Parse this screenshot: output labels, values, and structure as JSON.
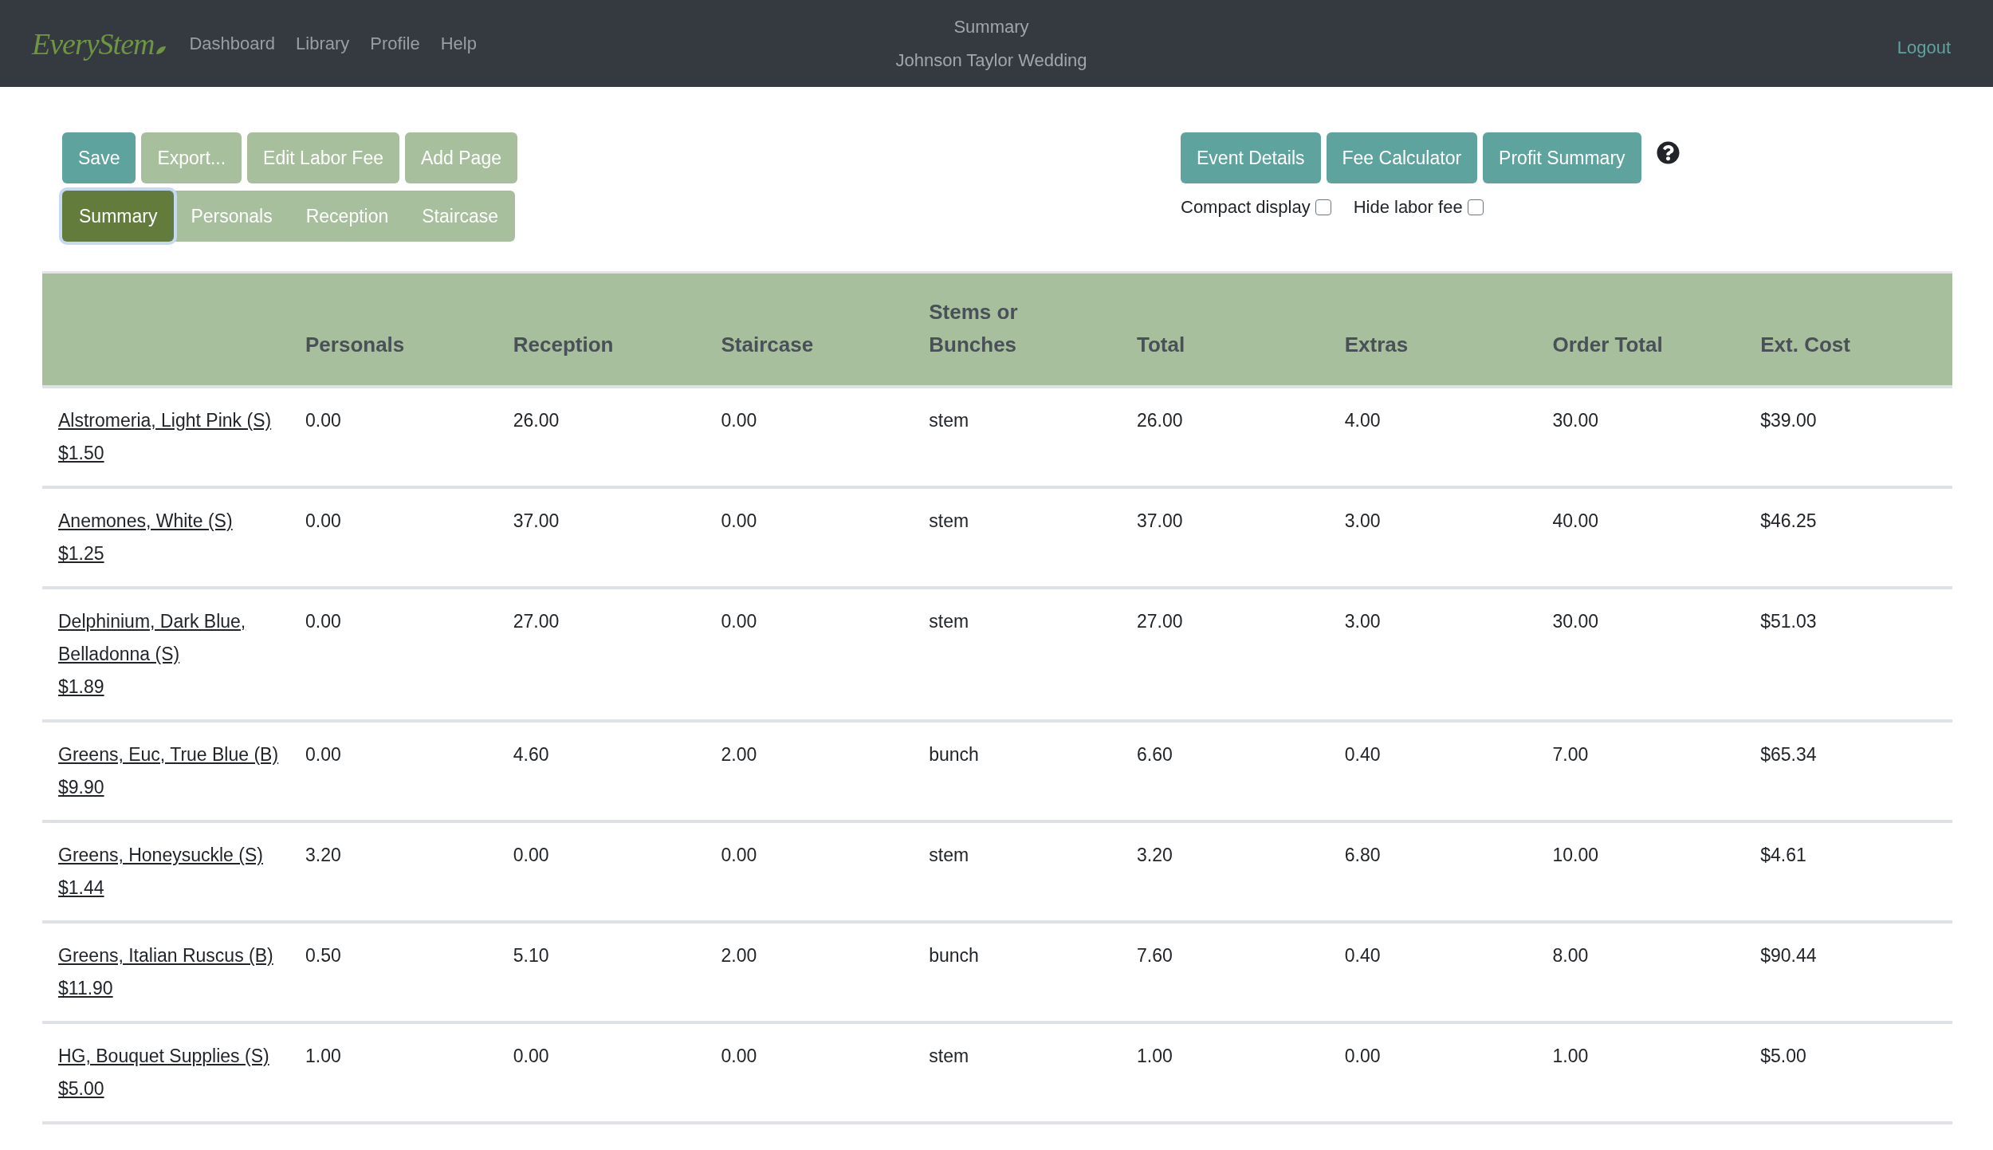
{
  "header": {
    "logo": "EveryStem",
    "nav": [
      {
        "label": "Dashboard"
      },
      {
        "label": "Library"
      },
      {
        "label": "Profile"
      },
      {
        "label": "Help"
      }
    ],
    "title": "Summary",
    "subtitle": "Johnson Taylor Wedding",
    "logout": "Logout"
  },
  "actions": [
    {
      "label": "Save",
      "kind": "primary"
    },
    {
      "label": "Export...",
      "kind": "secondary"
    },
    {
      "label": "Edit Labor Fee",
      "kind": "secondary"
    },
    {
      "label": "Add Page",
      "kind": "secondary"
    }
  ],
  "tabs": [
    {
      "label": "Summary",
      "selected": true
    },
    {
      "label": "Personals",
      "selected": false
    },
    {
      "label": "Reception",
      "selected": false
    },
    {
      "label": "Staircase",
      "selected": false
    }
  ],
  "tools": [
    {
      "label": "Event Details"
    },
    {
      "label": "Fee Calculator"
    },
    {
      "label": "Profit Summary"
    }
  ],
  "options": [
    {
      "label": "Compact display",
      "checked": false
    },
    {
      "label": "Hide labor fee",
      "checked": false
    }
  ],
  "table": {
    "columns": [
      "Personals",
      "Reception",
      "Staircase",
      "Stems or Bunches",
      "Total",
      "Extras",
      "Order Total",
      "Ext. Cost"
    ],
    "rows": [
      {
        "item": "Alstromeria, Light Pink (S)",
        "price": "$1.50",
        "cells": [
          "0.00",
          "26.00",
          "0.00",
          "stem",
          "26.00",
          "4.00",
          "30.00",
          "$39.00"
        ]
      },
      {
        "item": "Anemones, White (S)",
        "price": "$1.25",
        "cells": [
          "0.00",
          "37.00",
          "0.00",
          "stem",
          "37.00",
          "3.00",
          "40.00",
          "$46.25"
        ]
      },
      {
        "item": "Delphinium, Dark Blue, Belladonna (S)",
        "price": "$1.89",
        "cells": [
          "0.00",
          "27.00",
          "0.00",
          "stem",
          "27.00",
          "3.00",
          "30.00",
          "$51.03"
        ]
      },
      {
        "item": "Greens, Euc, True Blue (B)",
        "price": "$9.90",
        "cells": [
          "0.00",
          "4.60",
          "2.00",
          "bunch",
          "6.60",
          "0.40",
          "7.00",
          "$65.34"
        ]
      },
      {
        "item": "Greens, Honeysuckle (S)",
        "price": "$1.44",
        "cells": [
          "3.20",
          "0.00",
          "0.00",
          "stem",
          "3.20",
          "6.80",
          "10.00",
          "$4.61"
        ]
      },
      {
        "item": "Greens, Italian Ruscus (B)",
        "price": "$11.90",
        "cells": [
          "0.50",
          "5.10",
          "2.00",
          "bunch",
          "7.60",
          "0.40",
          "8.00",
          "$90.44"
        ]
      },
      {
        "item": "HG, Bouquet Supplies (S)",
        "price": "$5.00",
        "cells": [
          "1.00",
          "0.00",
          "0.00",
          "stem",
          "1.00",
          "0.00",
          "1.00",
          "$5.00"
        ]
      }
    ]
  }
}
